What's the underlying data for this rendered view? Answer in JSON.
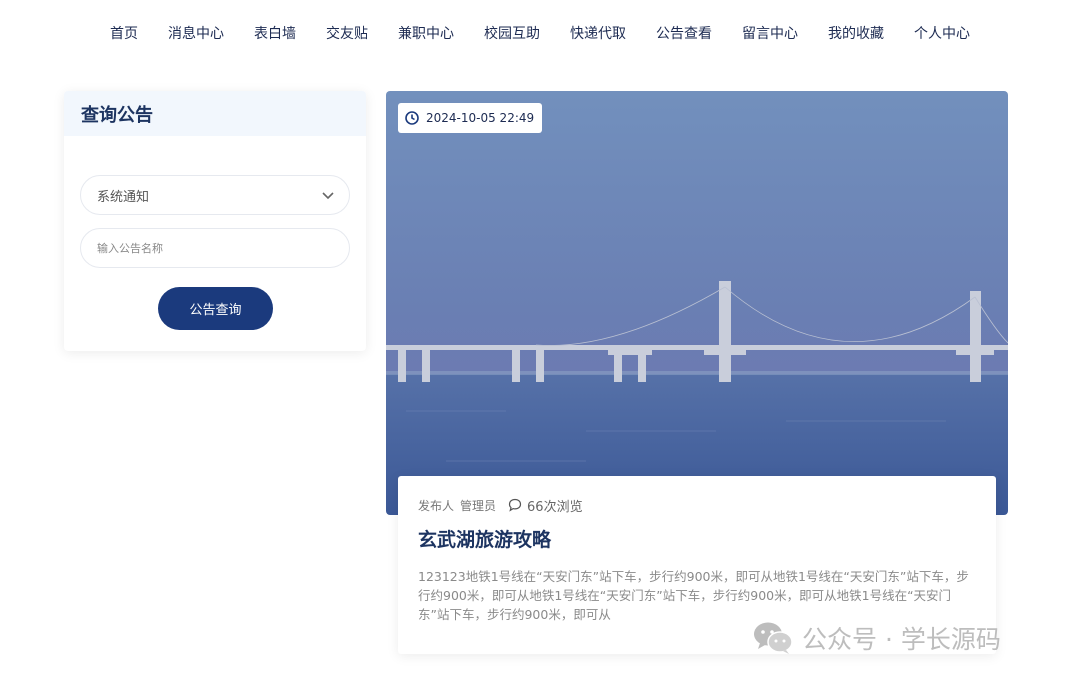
{
  "nav": {
    "items": [
      "首页",
      "消息中心",
      "表白墙",
      "交友贴",
      "兼职中心",
      "校园互助",
      "快递代取",
      "公告查看",
      "留言中心",
      "我的收藏",
      "个人中心"
    ]
  },
  "search_panel": {
    "title": "查询公告",
    "category_selected": "系统通知",
    "name_placeholder": "输入公告名称",
    "query_button": "公告查询"
  },
  "notice": {
    "date": "2024-10-05 22:49",
    "author_label": "发布人",
    "author": "管理员",
    "views": "66次浏览",
    "title": "玄武湖旅游攻略",
    "body": "123123地铁1号线在“天安门东”站下车，步行约900米，即可从地铁1号线在“天安门东”站下车，步行约900米，即可从地铁1号线在“天安门东”站下车，步行约900米，即可从地铁1号线在“天安门东”站下车，步行约900米，即可从"
  },
  "watermark": {
    "text": "公众号 · 学长源码",
    "icon": "wechat-icon"
  },
  "colors": {
    "accent": "#1b3a7d",
    "title": "#1d3461",
    "panel_head_bg": "#f2f7fd",
    "sky": "#6d87b8",
    "water": "#3f5f9c"
  }
}
